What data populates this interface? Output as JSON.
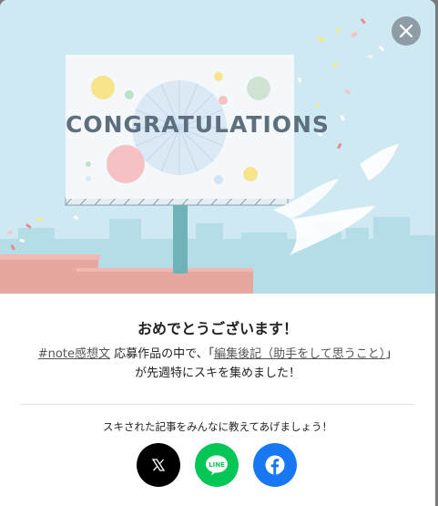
{
  "hero": {
    "billboard_text": "CONGRATULATIONS"
  },
  "close": {
    "icon": "close-icon"
  },
  "title": "おめでとうございます！",
  "message": {
    "hashtag": "#note感想文",
    "text_1": " 応募作品の中で、「",
    "article_link": "編集後記（助手をして思うこと）",
    "text_2": "」",
    "text_3": "が先週特にスキを集めました！"
  },
  "share": {
    "prompt": "スキされた記事をみんなに教えてあげましょう！",
    "buttons": [
      {
        "name": "x",
        "label": "X",
        "icon": "x-logo-icon",
        "color": "#000000"
      },
      {
        "name": "line",
        "label": "LINE",
        "icon": "line-logo-icon",
        "color": "#06c755"
      },
      {
        "name": "facebook",
        "label": "f",
        "icon": "facebook-logo-icon",
        "color": "#1877f2"
      }
    ]
  }
}
